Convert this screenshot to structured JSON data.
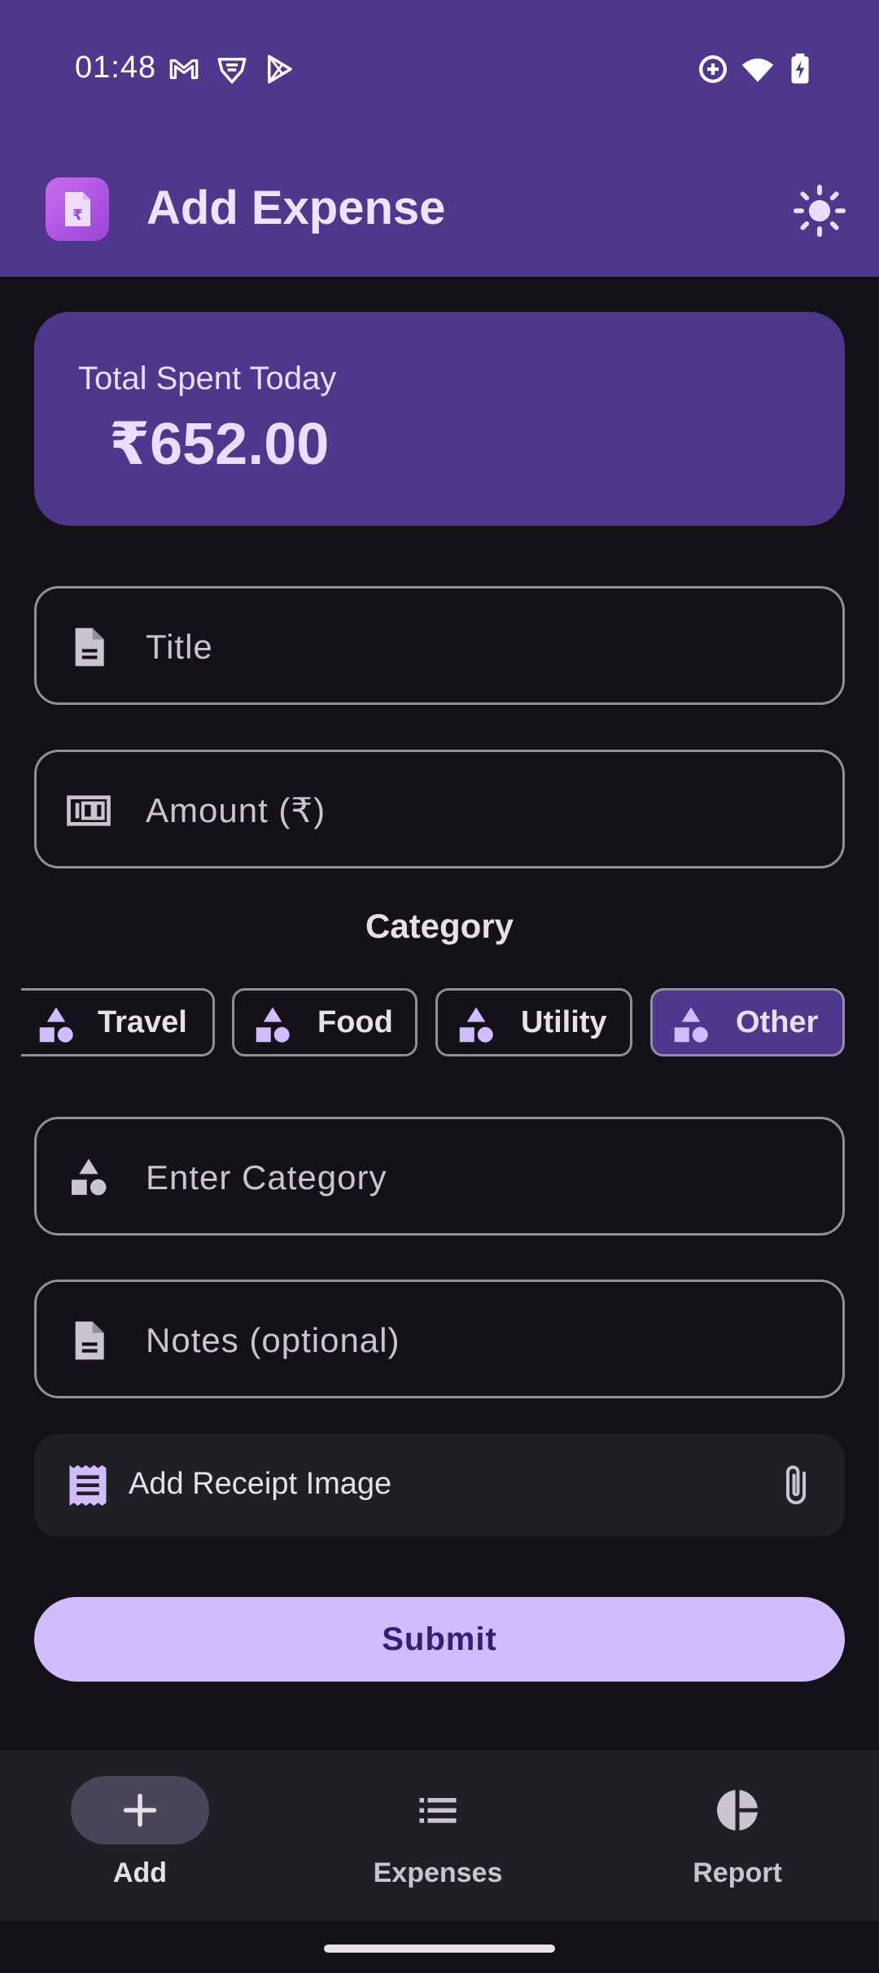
{
  "status_bar": {
    "time": "01:48",
    "left_icons": [
      "gmail-icon",
      "vpn-shield-icon",
      "play-store-icon"
    ],
    "right_icons": [
      "data-saver-icon",
      "wifi-icon",
      "battery-charging-icon"
    ]
  },
  "app_bar": {
    "title": "Add Expense",
    "logo_icon": "receipt-rupee-icon",
    "theme_icon": "sun-icon"
  },
  "summary": {
    "label": "Total Spent Today",
    "amount": "₹652.00"
  },
  "form": {
    "title_placeholder": "Title",
    "amount_placeholder": "Amount (₹)",
    "category_heading": "Category",
    "category_placeholder": "Enter Category",
    "notes_placeholder": "Notes (optional)"
  },
  "categories": [
    {
      "label": "Travel",
      "selected": false
    },
    {
      "label": "Food",
      "selected": false
    },
    {
      "label": "Utility",
      "selected": false
    },
    {
      "label": "Other",
      "selected": true
    }
  ],
  "receipt": {
    "label": "Add Receipt Image",
    "icon": "receipt-icon",
    "attach_icon": "paperclip-icon"
  },
  "submit_label": "Submit",
  "bottom_nav": [
    {
      "label": "Add",
      "icon": "plus-icon",
      "active": true
    },
    {
      "label": "Expenses",
      "icon": "list-icon",
      "active": false
    },
    {
      "label": "Report",
      "icon": "pie-chart-icon",
      "active": false
    }
  ],
  "colors": {
    "primary_container": "#4F378B",
    "primary": "#D0BCFF",
    "background": "#141218",
    "surface": "#211F26",
    "outline": "#938F99",
    "accent_icon": "#D0BCFF"
  }
}
